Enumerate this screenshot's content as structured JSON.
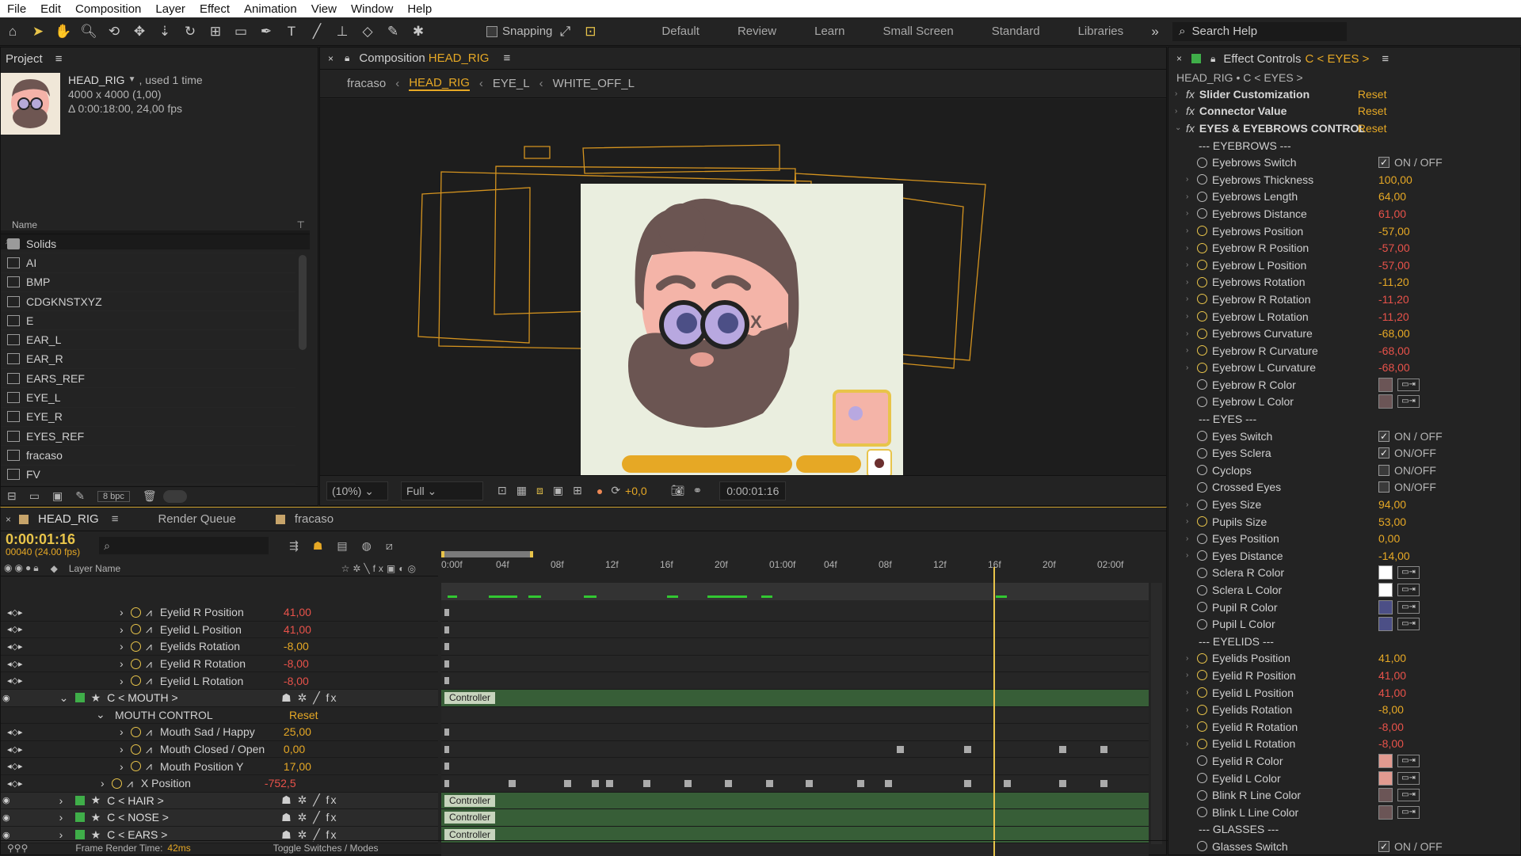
{
  "menu": [
    "File",
    "Edit",
    "Composition",
    "Layer",
    "Effect",
    "Animation",
    "View",
    "Window",
    "Help"
  ],
  "toolbar": {
    "snapping": "Snapping",
    "workspaces": [
      "Default",
      "Review",
      "Learn",
      "Small Screen",
      "Standard",
      "Libraries"
    ],
    "search": "Search Help"
  },
  "project": {
    "title": "Project",
    "comp_name": "HEAD_RIG",
    "used": ", used 1 time",
    "size": "4000 x 4000 (1,00)",
    "duration": "Δ 0:00:18:00, 24,00 fps",
    "column": "Name",
    "items": [
      "Solids",
      "AI",
      "BMP",
      "CDGKNSTXYZ",
      "E",
      "EAR_L",
      "EAR_R",
      "EARS_REF",
      "EYE_L",
      "EYE_R",
      "EYES_REF",
      "fracaso",
      "FV"
    ],
    "bpc": "8 bpc"
  },
  "composition": {
    "title_prefix": "Composition",
    "title_name": "HEAD_RIG",
    "breadcrumbs": [
      "fracaso",
      "HEAD_RIG",
      "EYE_L",
      "WHITE_OFF_L"
    ],
    "zoom": "(10%)",
    "quality": "Full",
    "exposure": "+0,0",
    "timecode": "0:00:01:16"
  },
  "effect_controls": {
    "title": "Effect Controls",
    "layer": "C < EYES >",
    "path": "HEAD_RIG • C < EYES >",
    "effects": [
      {
        "name": "Slider Customization",
        "reset": "Reset"
      },
      {
        "name": "Connector Value",
        "reset": "Reset"
      },
      {
        "name": "EYES & EYEBROWS CONTROL",
        "reset": "Reset"
      }
    ],
    "rows": [
      {
        "k": "sep",
        "name": "--- EYEBROWS ---"
      },
      {
        "k": "chk",
        "name": "Eyebrows Switch",
        "val": "ON / OFF",
        "on": true
      },
      {
        "k": "num",
        "name": "Eyebrows Thickness",
        "val": "100,00",
        "c": "orange"
      },
      {
        "k": "num",
        "name": "Eyebrows Length",
        "val": "64,00",
        "c": "orange"
      },
      {
        "k": "num",
        "name": "Eyebrows Distance",
        "val": "61,00",
        "c": "red"
      },
      {
        "k": "num",
        "name": "Eyebrows Position",
        "val": "-57,00",
        "c": "orange",
        "kf": true
      },
      {
        "k": "num",
        "name": "Eyebrow R Position",
        "val": "-57,00",
        "c": "red",
        "kf": true
      },
      {
        "k": "num",
        "name": "Eyebrow L Position",
        "val": "-57,00",
        "c": "red",
        "kf": true
      },
      {
        "k": "num",
        "name": "Eyebrows Rotation",
        "val": "-11,20",
        "c": "orange",
        "kf": true
      },
      {
        "k": "num",
        "name": "Eyebrow R Rotation",
        "val": "-11,20",
        "c": "red",
        "kf": true
      },
      {
        "k": "num",
        "name": "Eyebrow L Rotation",
        "val": "-11,20",
        "c": "red",
        "kf": true
      },
      {
        "k": "num",
        "name": "Eyebrows Curvature",
        "val": "-68,00",
        "c": "orange",
        "kf": true
      },
      {
        "k": "num",
        "name": "Eyebrow R Curvature",
        "val": "-68,00",
        "c": "red",
        "kf": true
      },
      {
        "k": "num",
        "name": "Eyebrow L Curvature",
        "val": "-68,00",
        "c": "red",
        "kf": true
      },
      {
        "k": "col",
        "name": "Eyebrow R Color",
        "color": "#6b5556"
      },
      {
        "k": "col",
        "name": "Eyebrow L Color",
        "color": "#6b5556"
      },
      {
        "k": "sep",
        "name": "--- EYES ---"
      },
      {
        "k": "chk",
        "name": "Eyes Switch",
        "val": "ON / OFF",
        "on": true
      },
      {
        "k": "chk",
        "name": "Eyes Sclera",
        "val": "ON/OFF",
        "on": true
      },
      {
        "k": "chk",
        "name": "Cyclops",
        "val": "ON/OFF",
        "on": false
      },
      {
        "k": "chk",
        "name": "Crossed Eyes",
        "val": "ON/OFF",
        "on": false
      },
      {
        "k": "num",
        "name": "Eyes Size",
        "val": "94,00",
        "c": "orange"
      },
      {
        "k": "num",
        "name": "Pupils Size",
        "val": "53,00",
        "c": "orange",
        "kf": true
      },
      {
        "k": "num",
        "name": "Eyes Position",
        "val": "0,00",
        "c": "orange"
      },
      {
        "k": "num",
        "name": "Eyes Distance",
        "val": "-14,00",
        "c": "orange"
      },
      {
        "k": "col",
        "name": "Sclera R Color",
        "color": "#ffffff"
      },
      {
        "k": "col",
        "name": "Sclera L Color",
        "color": "#ffffff"
      },
      {
        "k": "col",
        "name": "Pupil R Color",
        "color": "#4c4f86"
      },
      {
        "k": "col",
        "name": "Pupil L Color",
        "color": "#4c4f86"
      },
      {
        "k": "sep",
        "name": "--- EYELIDS ---"
      },
      {
        "k": "num",
        "name": "Eyelids Position",
        "val": "41,00",
        "c": "orange",
        "kf": true
      },
      {
        "k": "num",
        "name": "Eyelid R Position",
        "val": "41,00",
        "c": "red",
        "kf": true
      },
      {
        "k": "num",
        "name": "Eyelid L Position",
        "val": "41,00",
        "c": "red",
        "kf": true
      },
      {
        "k": "num",
        "name": "Eyelids Rotation",
        "val": "-8,00",
        "c": "orange",
        "kf": true
      },
      {
        "k": "num",
        "name": "Eyelid R Rotation",
        "val": "-8,00",
        "c": "red",
        "kf": true
      },
      {
        "k": "num",
        "name": "Eyelid L Rotation",
        "val": "-8,00",
        "c": "red",
        "kf": true
      },
      {
        "k": "col",
        "name": "Eyelid R Color",
        "color": "#e19a90"
      },
      {
        "k": "col",
        "name": "Eyelid L Color",
        "color": "#e19a90"
      },
      {
        "k": "col",
        "name": "Blink R Line Color",
        "color": "#6b5556"
      },
      {
        "k": "col",
        "name": "Blink L Line Color",
        "color": "#6b5556"
      },
      {
        "k": "sep",
        "name": "--- GLASSES ---"
      },
      {
        "k": "chk",
        "name": "Glasses Switch",
        "val": "ON / OFF",
        "on": true
      }
    ]
  },
  "timeline": {
    "tabs": [
      "HEAD_RIG",
      "Render Queue",
      "fracaso"
    ],
    "timecode": "0:00:01:16",
    "frames": "00040 (24.00 fps)",
    "column": "Layer Name",
    "ruler": [
      "0:00f",
      "04f",
      "08f",
      "12f",
      "16f",
      "20f",
      "01:00f",
      "04f",
      "08f",
      "12f",
      "16f",
      "20f",
      "02:00f"
    ],
    "controller_label": "Controller",
    "layers": [
      {
        "t": "prop",
        "name": "Eyelid R Position",
        "val": "41,00",
        "c": "red",
        "ind": 2
      },
      {
        "t": "prop",
        "name": "Eyelid L Position",
        "val": "41,00",
        "c": "red",
        "ind": 2
      },
      {
        "t": "prop",
        "name": "Eyelids Rotation",
        "val": "-8,00",
        "c": "orange",
        "ind": 2
      },
      {
        "t": "prop",
        "name": "Eyelid R Rotation",
        "val": "-8,00",
        "c": "red",
        "ind": 2
      },
      {
        "t": "prop",
        "name": "Eyelid L Rotation",
        "val": "-8,00",
        "c": "red",
        "ind": 2
      },
      {
        "t": "layer",
        "name": "C < MOUTH >"
      },
      {
        "t": "group",
        "name": "MOUTH CONTROL",
        "val": "Reset"
      },
      {
        "t": "prop",
        "name": "Mouth Sad / Happy",
        "val": "25,00",
        "c": "orange",
        "ind": 2
      },
      {
        "t": "prop",
        "name": "Mouth Closed / Open",
        "val": "0,00",
        "c": "orange",
        "ind": 2
      },
      {
        "t": "prop",
        "name": "Mouth Position Y",
        "val": "17,00",
        "c": "orange",
        "ind": 2
      },
      {
        "t": "prop",
        "name": "X Position",
        "val": "-752,5",
        "c": "red",
        "ind": 1
      },
      {
        "t": "layer",
        "name": "C < HAIR >"
      },
      {
        "t": "layer",
        "name": "C < NOSE >"
      },
      {
        "t": "layer",
        "name": "C < EARS >"
      }
    ],
    "footer": {
      "render_time_label": "Frame Render Time:",
      "render_time": "42ms",
      "toggle": "Toggle Switches / Modes"
    }
  }
}
